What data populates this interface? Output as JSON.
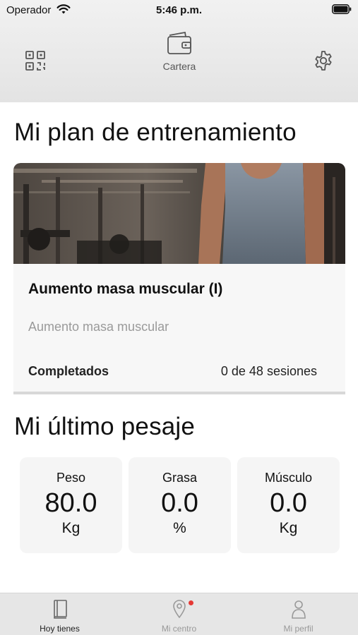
{
  "status_bar": {
    "carrier": "Operador",
    "time": "5:46 p.m."
  },
  "top_bar": {
    "wallet_label": "Cartera"
  },
  "plan": {
    "section_title": "Mi plan de entrenamiento",
    "name": "Aumento masa muscular (I)",
    "subtitle": "Aumento masa muscular",
    "completed_label": "Completados",
    "completed_value": "0 de 48 sesiones"
  },
  "weigh_in": {
    "section_title": "Mi último pesaje",
    "stats": [
      {
        "label": "Peso",
        "value": "80.0",
        "unit": "Kg"
      },
      {
        "label": "Grasa",
        "value": "0.0",
        "unit": "%"
      },
      {
        "label": "Músculo",
        "value": "0.0",
        "unit": "Kg"
      }
    ]
  },
  "tabs": [
    {
      "label": "Hoy tienes",
      "icon": "book-icon"
    },
    {
      "label": "Mi centro",
      "icon": "location-pin-icon"
    },
    {
      "label": "Mi perfil",
      "icon": "person-icon"
    }
  ]
}
